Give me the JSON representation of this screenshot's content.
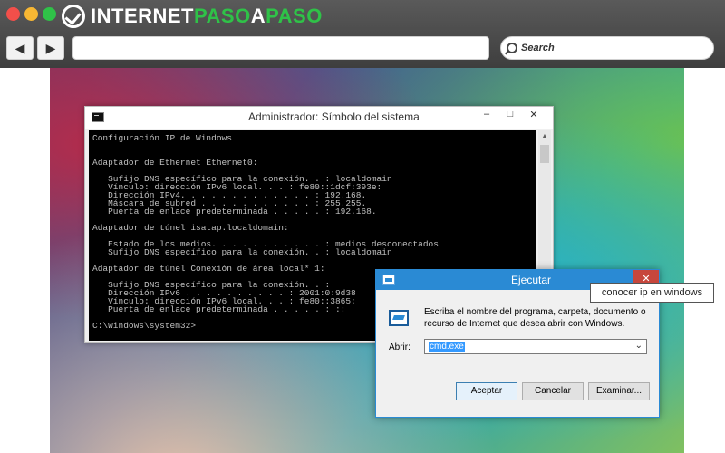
{
  "browser": {
    "logo_part1": "INTERNET",
    "logo_part2": "PASO",
    "logo_part3": "A",
    "logo_part4": "PASO",
    "back_icon": "back-arrow-icon",
    "forward_icon": "forward-arrow-icon",
    "search_placeholder": "Search",
    "colors": {
      "logo_accent": "#2fc248",
      "close_dot": "#f24f4a",
      "minimize_dot": "#f7b733",
      "maximize_dot": "#2fc248"
    }
  },
  "cmd_window": {
    "title": "Administrador: Símbolo del sistema",
    "minimize": "–",
    "maximize": "□",
    "close": "✕",
    "lines": [
      "Configuración IP de Windows",
      "",
      "",
      "Adaptador de Ethernet Ethernet0:",
      "",
      "   Sufijo DNS específico para la conexión. . : localdomain",
      "   Vínculo: dirección IPv6 local. . . : fe80::1dcf:393e:",
      "   Dirección IPv4. . . . . . . . . . . . . : 192.168.",
      "   Máscara de subred . . . . . . . . . . . : 255.255.",
      "   Puerta de enlace predeterminada . . . . . : 192.168.",
      "",
      "Adaptador de túnel isatap.localdomain:",
      "",
      "   Estado de los medios. . . . . . . . . . . : medios desconectados",
      "   Sufijo DNS específico para la conexión. . : localdomain",
      "",
      "Adaptador de túnel Conexión de área local* 1:",
      "",
      "   Sufijo DNS específico para la conexión. . :",
      "   Dirección IPv6 . . . . . . . . . . : 2001:0:9d38",
      "   Vínculo: dirección IPv6 local. . . : fe80::3865:",
      "   Puerta de enlace predeterminada . . . . . : ::",
      "",
      "C:\\Windows\\system32>"
    ]
  },
  "run_dialog": {
    "title": "Ejecutar",
    "close": "✕",
    "description": "Escriba el nombre del programa, carpeta, documento o recurso de Internet que desea abrir con Windows.",
    "open_label": "Abrir:",
    "open_value": "cmd.exe",
    "dropdown_arrow": "⌄",
    "ok_label": "Aceptar",
    "cancel_label": "Cancelar",
    "browse_label": "Examinar..."
  },
  "tooltip": {
    "text": "conocer ip en windows"
  }
}
